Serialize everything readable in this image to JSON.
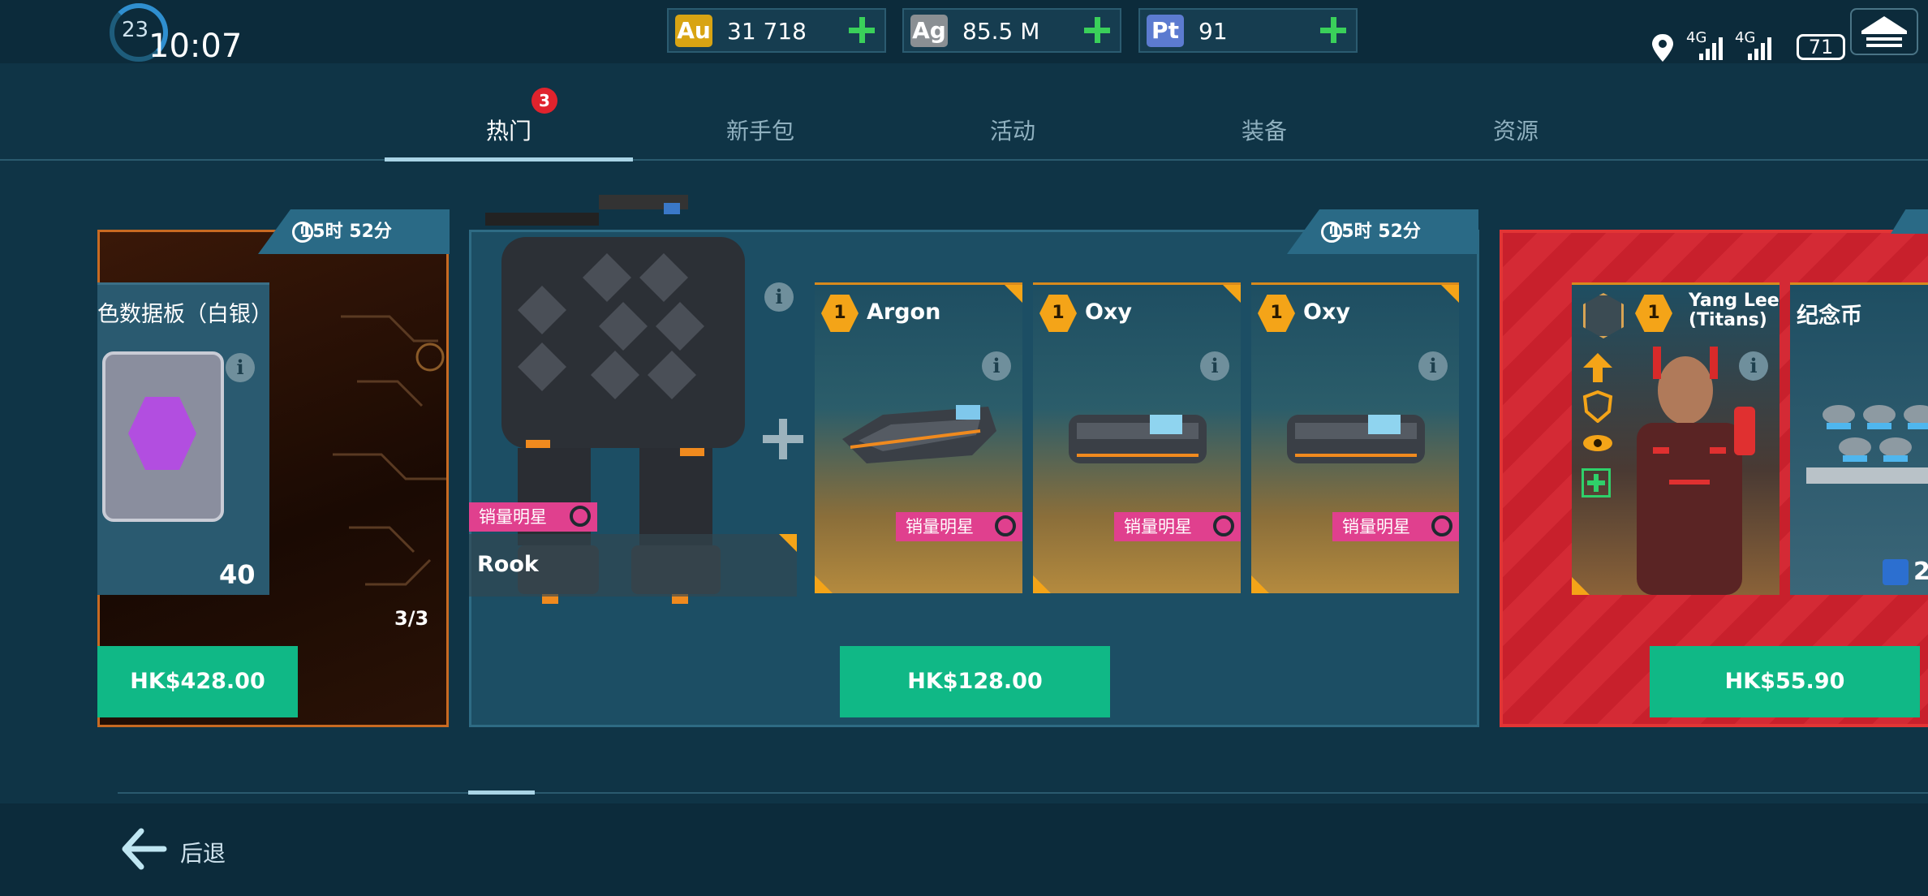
{
  "status_bar": {
    "level": "23",
    "time": "10:07",
    "network_1": "4G",
    "network_2": "4G",
    "battery": "71",
    "icons": [
      "location-icon",
      "signal-icon",
      "battery-icon",
      "hangar-icon"
    ]
  },
  "currencies": [
    {
      "symbol": "Au",
      "value": "31 718",
      "color": "#d8a413"
    },
    {
      "symbol": "Ag",
      "value": "85.5 M",
      "color": "#8a8f93"
    },
    {
      "symbol": "Pt",
      "value": "91",
      "color": "#5c7bd0"
    }
  ],
  "tabs": [
    {
      "label": "热门",
      "active": true,
      "badge": "3"
    },
    {
      "label": "新手包",
      "active": false
    },
    {
      "label": "活动",
      "active": false
    },
    {
      "label": "装备",
      "active": false
    },
    {
      "label": "资源",
      "active": false
    }
  ],
  "offers": {
    "left": {
      "timer": "15时 52分",
      "item_name": "色数据板（白银）",
      "quantity": "40",
      "stock": "3/3",
      "price": "HK$428.00"
    },
    "middle": {
      "timer": "15时 52分",
      "robot_name": "Rook",
      "robot_tag": "销量明星",
      "cards": [
        {
          "level": "1",
          "name": "Argon",
          "tag": "销量明星"
        },
        {
          "level": "1",
          "name": "Oxy",
          "tag": "销量明星"
        },
        {
          "level": "1",
          "name": "Oxy",
          "tag": "销量明星"
        }
      ],
      "price": "HK$128.00"
    },
    "right": {
      "pilot_level": "1",
      "pilot_name_1": "Yang Lee",
      "pilot_name_2": "(Titans)",
      "coin_label": "纪念币",
      "coin_qty": "2",
      "price": "HK$55.90"
    }
  },
  "footer": {
    "back_label": "后退"
  },
  "colors": {
    "accent_green": "#10b886",
    "badge_red": "#e0232d",
    "tag_pink": "#e0408e",
    "level_gold": "#f4a418"
  }
}
